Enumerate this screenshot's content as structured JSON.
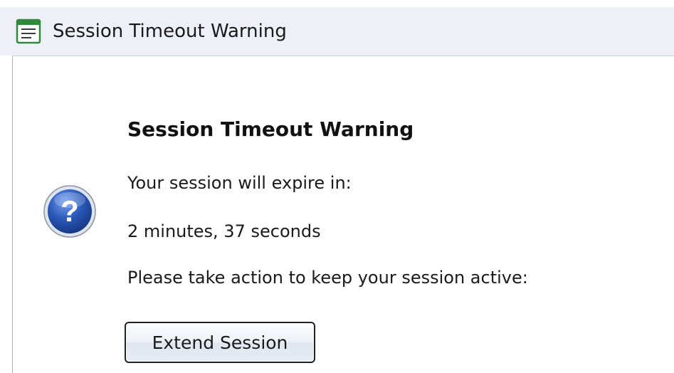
{
  "window": {
    "title": "Session Timeout Warning",
    "title_icon": "window-form-icon"
  },
  "dialog": {
    "icon": "question-mark-icon",
    "heading": "Session Timeout Warning",
    "expire_label": "Your session will expire in:",
    "time_remaining": "2 minutes, 37 seconds",
    "action_prompt": "Please take action to keep your session active:",
    "extend_button_label": "Extend Session"
  },
  "colors": {
    "titlebar_bg": "#edf1f7",
    "icon_green": "#2f8a3c",
    "help_blue": "#2a57b8"
  }
}
